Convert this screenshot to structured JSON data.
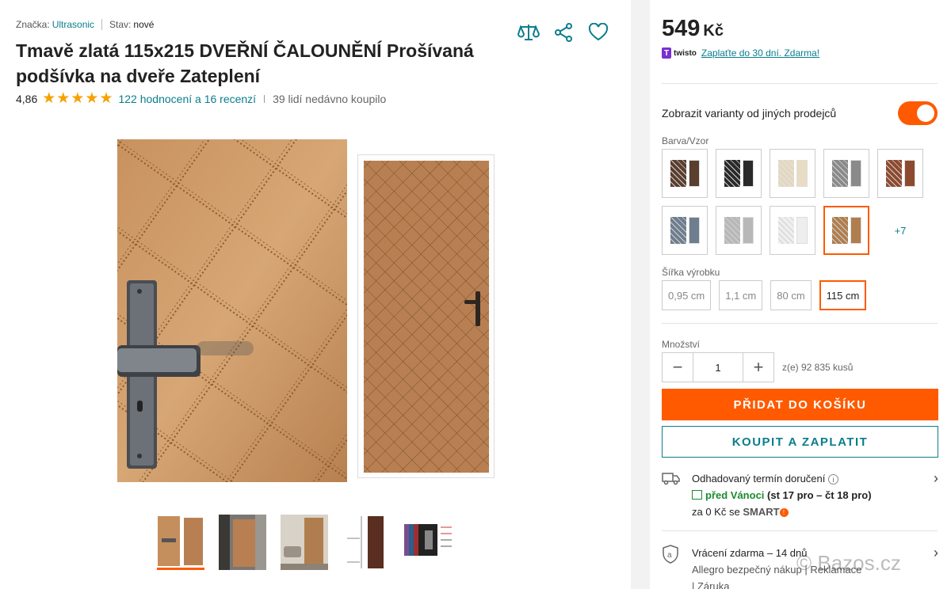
{
  "meta": {
    "brand_label": "Značka:",
    "brand_value": "Ultrasonic",
    "condition_label": "Stav:",
    "condition_value": "nové"
  },
  "product": {
    "title": "Tmavě zlatá 115x215 DVEŘNÍ ČALOUNĚNÍ Prošívaná podšívka na dveře Zateplení",
    "rating": "4,86",
    "stars_filled": 5,
    "reviews_link": "122 hodnocení a 16 recenzí",
    "bought_recently": "39 lidí nedávno koupilo"
  },
  "icons": {
    "compare": "compare-scales-icon",
    "share": "share-icon",
    "favorite": "heart-icon"
  },
  "thumbnails": [
    {
      "name": "quilted-detail-and-door",
      "active": true
    },
    {
      "name": "interior-hallway-door",
      "active": false
    },
    {
      "name": "living-room-door",
      "active": false
    },
    {
      "name": "measurements-door",
      "active": false
    },
    {
      "name": "color-chart",
      "active": false
    }
  ],
  "buy_box": {
    "price": "549",
    "currency": "Kč",
    "twisto_logo": "twisto",
    "twisto_text": "Zaplaťte do 30 dní. Zdarma!",
    "variants_toggle_label": "Zobrazit varianty od jiných prodejců",
    "variants_toggle_on": true,
    "color_label": "Barva/Vzor",
    "colors": [
      {
        "name": "dark-brown",
        "color": "#5a3e2e",
        "active": false
      },
      {
        "name": "black",
        "color": "#2a2a2a",
        "active": false
      },
      {
        "name": "cream",
        "color": "#e8dcc4",
        "active": false
      },
      {
        "name": "gray",
        "color": "#8a8a8a",
        "active": false
      },
      {
        "name": "chestnut",
        "color": "#8e4a2e",
        "active": false
      },
      {
        "name": "steel-blue",
        "color": "#6e7e8e",
        "active": false
      },
      {
        "name": "silver",
        "color": "#b8b8b8",
        "active": false
      },
      {
        "name": "white",
        "color": "#eeeeee",
        "active": false
      },
      {
        "name": "dark-gold",
        "color": "#b07e4e",
        "active": true
      }
    ],
    "colors_more": "+7",
    "width_label": "Šířka výrobku",
    "widths": [
      {
        "label": "0,95 cm",
        "active": false
      },
      {
        "label": "1,1 cm",
        "active": false
      },
      {
        "label": "80 cm",
        "active": false
      },
      {
        "label": "115 cm",
        "active": true
      }
    ],
    "quantity_label": "Množství",
    "quantity_value": "1",
    "quantity_minus": "−",
    "quantity_plus": "+",
    "availability": "z(e) 92 835 kusů",
    "add_to_cart": "PŘIDAT DO KOŠÍKU",
    "buy_now": "KOUPIT A ZAPLATIT"
  },
  "delivery": {
    "title": "Odhadovaný termín doručení",
    "highlight": "před Vánoci",
    "dates": "(st 17 pro – čt 18 pro)",
    "price_prefix": "za 0 Kč se",
    "smart": "SMART",
    "smart_badge": "!"
  },
  "returns": {
    "title": "Vrácení zdarma – 14 dnů",
    "line2": "Allegro bezpečný nákup | Reklamace",
    "line3": "| Záruka"
  },
  "watermark": "© Bazos.cz"
}
